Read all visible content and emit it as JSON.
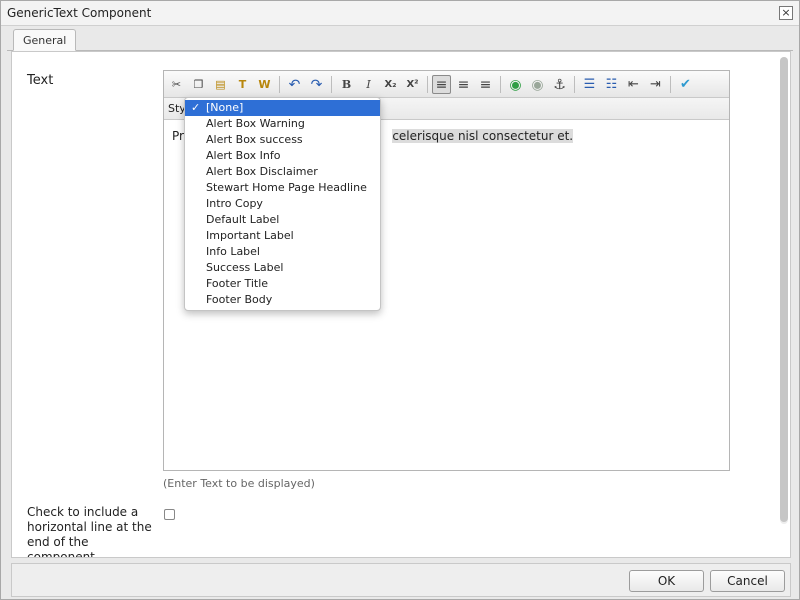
{
  "window": {
    "title": "GenericText Component",
    "close_glyph": "×"
  },
  "tabs": [
    {
      "label": "General"
    }
  ],
  "text_field": {
    "label": "Text",
    "help": "(Enter Text to be displayed)"
  },
  "toolbar": {
    "icons": [
      {
        "name": "cut-icon",
        "glyph": "✂"
      },
      {
        "name": "copy-icon",
        "glyph": "❐"
      },
      {
        "name": "paste-icon",
        "glyph": "📋"
      },
      {
        "name": "paste-plain-text-icon",
        "glyph": "T"
      },
      {
        "name": "paste-word-icon",
        "glyph": "W"
      },
      {
        "name": "undo-icon",
        "glyph": "↶"
      },
      {
        "name": "redo-icon",
        "glyph": "↷"
      },
      {
        "name": "bold-icon",
        "glyph": "B"
      },
      {
        "name": "italic-icon",
        "glyph": "I"
      },
      {
        "name": "subscript-icon",
        "glyph": "X₂"
      },
      {
        "name": "superscript-icon",
        "glyph": "X²"
      },
      {
        "name": "align-left-icon",
        "glyph": "≡"
      },
      {
        "name": "align-center-icon",
        "glyph": "≡"
      },
      {
        "name": "align-right-icon",
        "glyph": "≡"
      },
      {
        "name": "link-icon",
        "glyph": "🔗"
      },
      {
        "name": "unlink-icon",
        "glyph": "⛓"
      },
      {
        "name": "anchor-icon",
        "glyph": "⚓"
      },
      {
        "name": "bulleted-list-icon",
        "glyph": "☰"
      },
      {
        "name": "numbered-list-icon",
        "glyph": "☷"
      },
      {
        "name": "outdent-icon",
        "glyph": "⇤"
      },
      {
        "name": "indent-icon",
        "glyph": "⇥"
      },
      {
        "name": "spellcheck-icon",
        "glyph": "✔"
      }
    ]
  },
  "styles_bar": {
    "label": "Styl"
  },
  "editor": {
    "content_prefix": "Pra",
    "content_highlight": "celerisque nisl consectetur et."
  },
  "style_dropdown": {
    "check_glyph": "✓",
    "items": [
      "[None]",
      "Alert Box Warning",
      "Alert Box success",
      "Alert Box Info",
      "Alert Box Disclaimer",
      "Stewart Home Page Headline",
      "Intro Copy",
      "Default Label",
      "Important Label",
      "Info Label",
      "Success Label",
      "Footer Title",
      "Footer Body"
    ],
    "selected": "[None]"
  },
  "hr_checkbox": {
    "label": "Check to include a horizontal line at the end of the component",
    "checked": false
  },
  "buttons": {
    "ok": "OK",
    "cancel": "Cancel"
  },
  "colors": {
    "accent": "#2e6fd6",
    "link_icon": "#2f9e44"
  }
}
